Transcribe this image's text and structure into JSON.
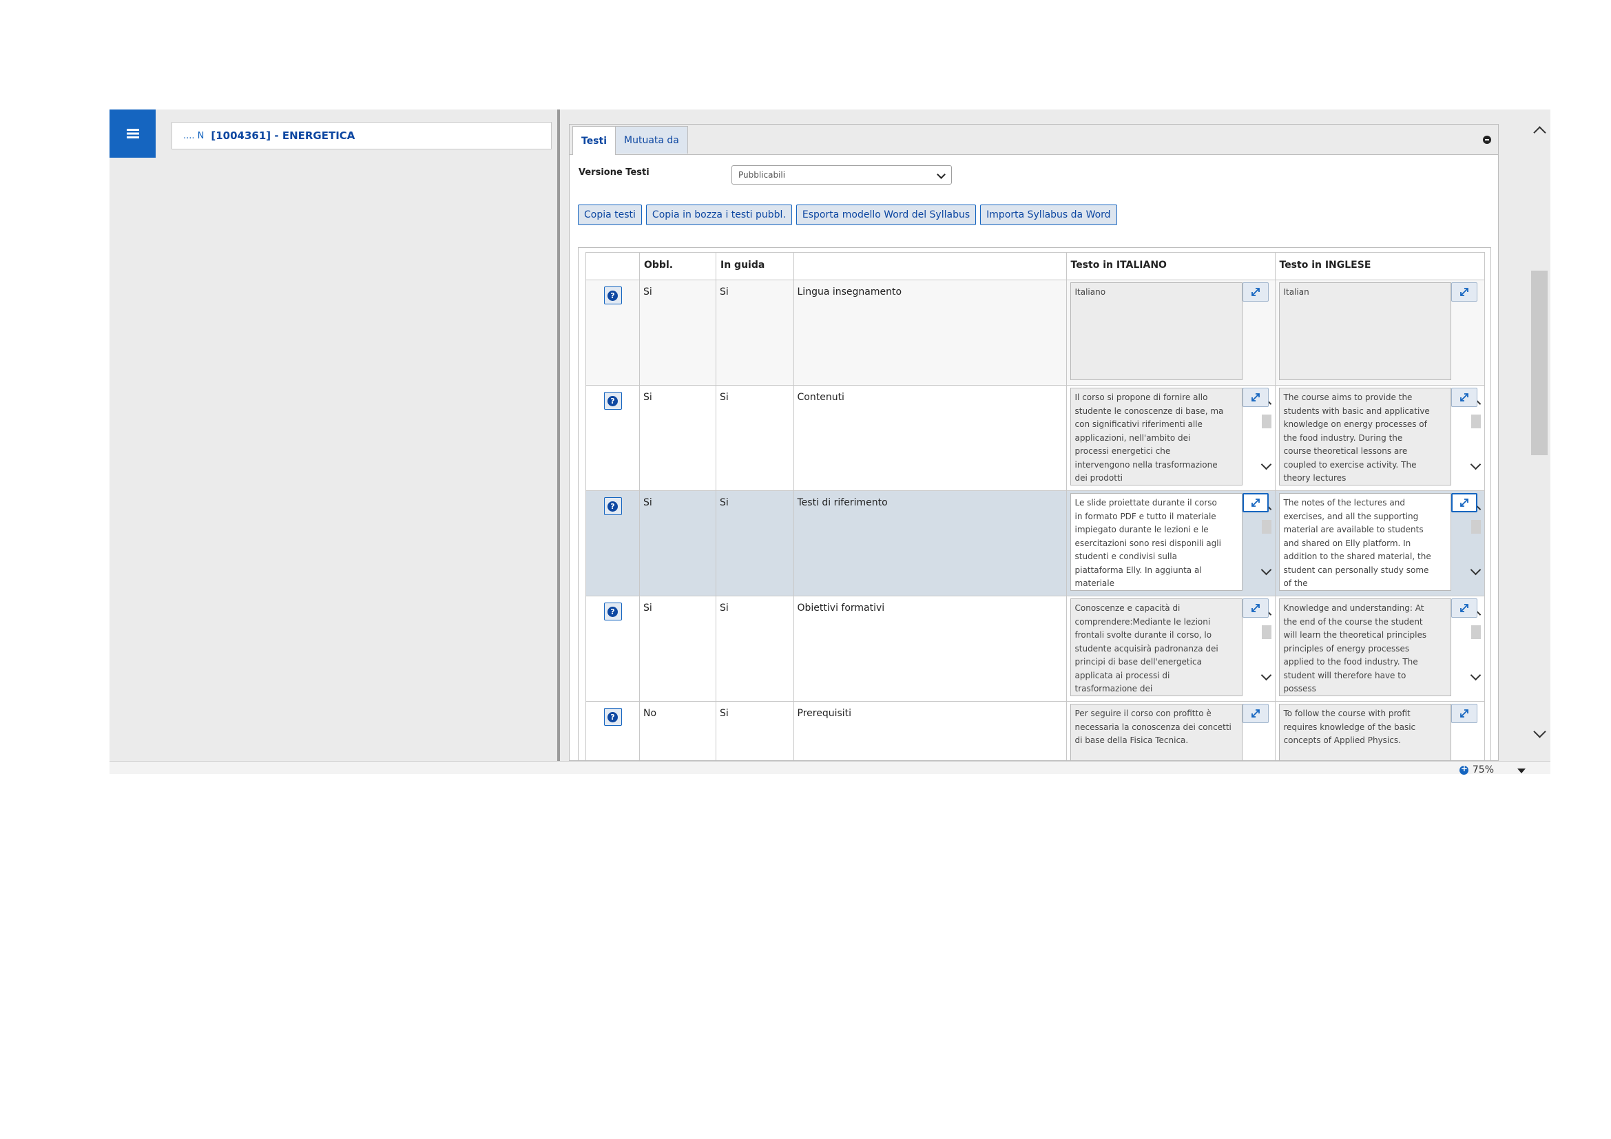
{
  "breadcrumb": {
    "prefix": ".... N",
    "title": "[1004361] - ENERGETICA"
  },
  "tabs": [
    {
      "label": "Testi",
      "active": true
    },
    {
      "label": "Mutuata da",
      "active": false
    }
  ],
  "version": {
    "label": "Versione Testi",
    "selected": "Pubblicabili"
  },
  "buttons": [
    "Copia testi",
    "Copia in bozza i testi pubbl.",
    "Esporta modello Word del Syllabus",
    "Importa Syllabus da Word"
  ],
  "table": {
    "headers": [
      "",
      "Obbl.",
      "In guida",
      "",
      "Testo in ITALIANO",
      "Testo in INGLESE"
    ],
    "rows": [
      {
        "obbl": "Si",
        "guida": "Si",
        "field": "Lingua insegnamento",
        "it": "Italiano",
        "en": "Italian"
      },
      {
        "obbl": "Si",
        "guida": "Si",
        "field": "Contenuti",
        "it": "Il corso si propone di fornire allo studente le conoscenze di base, ma con significativi riferimenti alle applicazioni, nell'ambito dei processi energetici che intervengono nella trasformazione dei prodotti",
        "en": "The course aims to provide the students with basic and applicative knowledge on energy processes of the food industry. During the course theoretical lessons are coupled to exercise activity. The theory lectures"
      },
      {
        "obbl": "Si",
        "guida": "Si",
        "field": "Testi di riferimento",
        "it": "Le slide proiettate durante il corso in formato PDF e tutto il materiale impiegato durante le lezioni e le esercitazioni sono resi disponili agli studenti e condivisi sulla piattaforma Elly. In aggiunta al materiale",
        "en": "The notes of the lectures and exercises, and all the supporting material are available to students and shared on Elly platform. In addition to the shared material, the student can personally study some of the"
      },
      {
        "obbl": "Si",
        "guida": "Si",
        "field": "Obiettivi formativi",
        "it": "Conoscenze e capacità di comprendere:Mediante le lezioni frontali svolte durante il corso, lo studente acquisirà padronanza dei principi di base dell'energetica applicata ai processi di trasformazione dei",
        "en": "Knowledge and understanding: At the end of the course the student will learn the theoretical principles principles of energy processes applied to the food industry. The student  will therefore have to possess"
      },
      {
        "obbl": "No",
        "guida": "Si",
        "field": "Prerequisiti",
        "it": "Per seguire il corso con profitto è necessaria la conoscenza dei concetti di base della Fisica Tecnica.",
        "en": "To follow the course with profit requires knowledge of the basic concepts of Applied Physics."
      }
    ]
  },
  "help_icon_glyph": "?",
  "status": {
    "zoom": "75%"
  },
  "colors": {
    "accent": "#1565c0",
    "selected_row": "#d4dde6"
  }
}
